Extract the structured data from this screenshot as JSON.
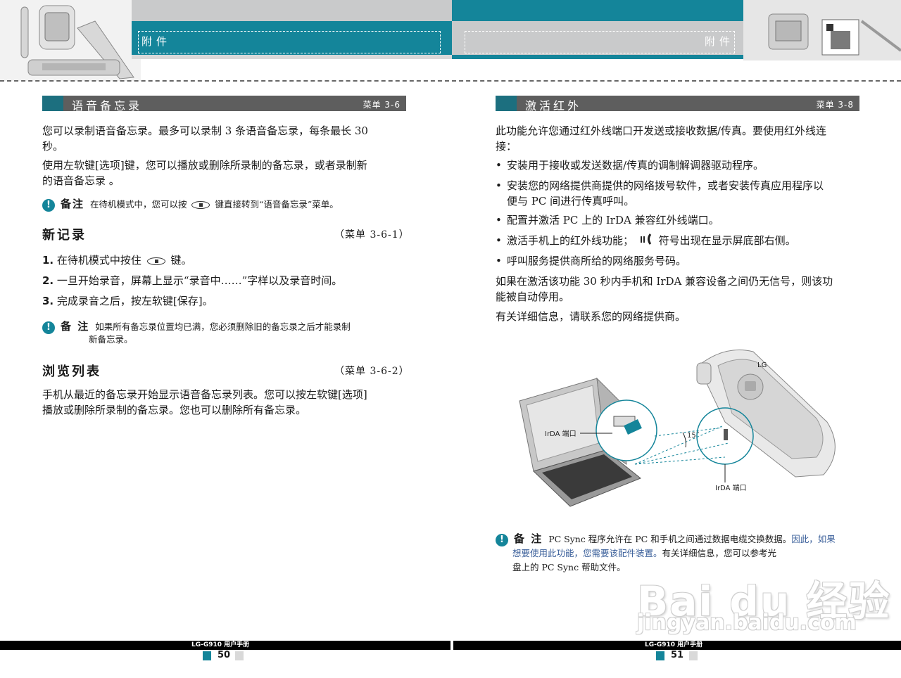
{
  "header": {
    "left_title": "附件",
    "right_title": "附件"
  },
  "left_page": {
    "section": {
      "title": "语音备忘录",
      "menu": "菜单 3-6"
    },
    "intro1": "您可以录制语音备忘录。最多可以录制 3 条语音备忘录，每条最长 30",
    "intro1b": "秒。",
    "intro2": "使用左软键[选项]键，您可以播放或删除所录制的备忘录，或者录制新",
    "intro2b": "的语音备忘录 。",
    "note1": {
      "label": "备注",
      "text_before": "在待机模式中，您可以按",
      "text_after": "键直接转到“语音备忘录”菜单。"
    },
    "sub1": {
      "title": "新记录",
      "menu": "（菜单 3-6-1）"
    },
    "steps": [
      {
        "num": "1.",
        "text_before": "在待机模式中按住",
        "text_after": "键。"
      },
      {
        "num": "2.",
        "text": "一旦开始录音，屏幕上显示“录音中……”字样以及录音时间。"
      },
      {
        "num": "3.",
        "text": "完成录音之后，按左软键[保存]。"
      }
    ],
    "note2": {
      "label": "备 注",
      "line1": "如果所有备忘录位置均已满，您必须删除旧的备忘录之后才能录制",
      "line2": "新备忘录。"
    },
    "sub2": {
      "title": "浏览列表",
      "menu": "（菜单 3-6-2）"
    },
    "list_text1": "手机从最近的备忘录开始显示语音备忘录列表。您可以按左软键[选项]",
    "list_text2": "播放或删除所录制的备忘录。您也可以删除所有备忘录。"
  },
  "right_page": {
    "section": {
      "title": "激活红外",
      "menu": "菜单 3-8"
    },
    "intro1": "此功能允许您通过红外线端口开发送或接收数据/传真。要使用红外线连",
    "intro1b": "接：",
    "bullets": [
      "安装用于接收或发送数据/传真的调制解调器驱动程序。",
      "安装您的网络提供商提供的网络拨号软件，或者安装传真应用程序以",
      "配置并激活 PC 上的 IrDA 兼容红外线端口。",
      "激活手机上的红外线功能；",
      "呼叫服务提供商所给的网络服务号码。"
    ],
    "bullet2_cont": "便与 PC 间进行传真呼叫。",
    "bullet4_cont": "符号出现在显示屏底部右侧。",
    "para1": "如果在激活该功能 30 秒内手机和 IrDA 兼容设备之间仍无信号，则该功",
    "para1b": "能被自动停用。",
    "para2": "有关详细信息，请联系您的网络提供商。",
    "illustration": {
      "laptop_label": "IrDA 端口",
      "phone_label": "IrDA 端口",
      "angle": "15˚",
      "brand": "LG"
    },
    "note": {
      "label": "备 注",
      "line1a": "PC Sync 程序允许在 PC 和手机之间通过数据电缆交换数据。",
      "line1b": "因此，如果",
      "line2a": "想要使用此功能，您需要该配件装置。",
      "line2b": "有关详细信息，您可以参考光",
      "line3": "盘上的 PC Sync 帮助文件。"
    }
  },
  "footer": {
    "left_label": "LG-G910 用户手册",
    "left_page": "50",
    "right_label": "LG-G910 用户手册",
    "right_page": "51"
  },
  "watermark": {
    "line1": "Bai du 经验",
    "line2": "jingyan.baidu.com"
  },
  "colors": {
    "teal": "#14859a",
    "dark_teal": "#1c6f7f",
    "bar_gray": "#5e5e5e",
    "light_gray": "#c9cacb"
  },
  "icons": [
    "phone-photo-icon",
    "accessory-box-icon",
    "note-exclamation-icon",
    "menu-key-icon",
    "infrared-signal-icon"
  ]
}
